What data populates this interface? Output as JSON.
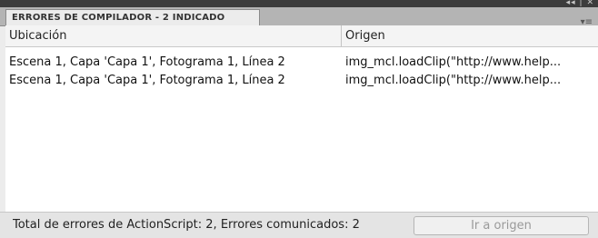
{
  "titlebar": {
    "controls": "◂◂ | ✕"
  },
  "tab": {
    "label": "ERRORES DE COMPILADOR - 2 INDICADO"
  },
  "panel_menu": {
    "icon": "panel-menu-icon",
    "glyph": "▾≡"
  },
  "table": {
    "columns": [
      "Ubicación",
      "Origen"
    ],
    "rows": [
      {
        "location": "Escena 1, Capa 'Capa 1', Fotograma 1, Línea 2",
        "source": "img_mcl.loadClip(\"http://www.help..."
      },
      {
        "location": "Escena 1, Capa 'Capa 1', Fotograma 1, Línea 2",
        "source": "img_mcl.loadClip(\"http://www.help..."
      }
    ]
  },
  "footer": {
    "status": "Total de errores de ActionScript: 2, Errores comunicados: 2",
    "go_button": "Ir a origen"
  }
}
